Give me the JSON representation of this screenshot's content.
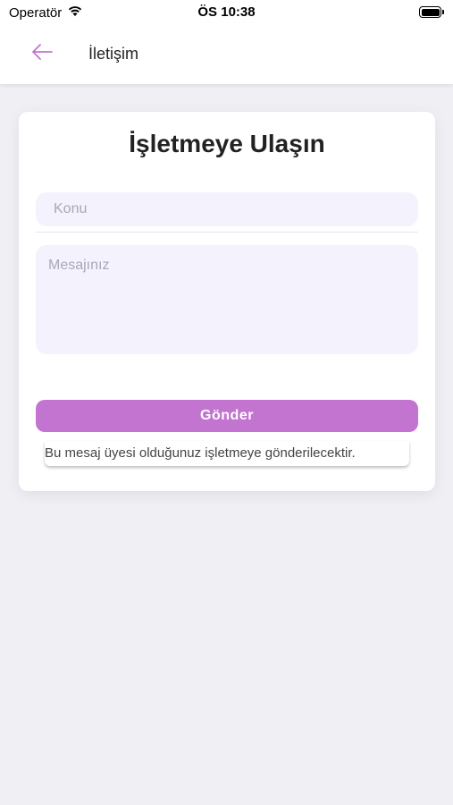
{
  "status_bar": {
    "carrier": "Operatör",
    "time": "ÖS 10:38"
  },
  "header": {
    "title": "İletişim",
    "back_icon": "arrow-left-icon",
    "accent_color": "#c374d1"
  },
  "form": {
    "title": "İşletmeye Ulaşın",
    "subject_placeholder": "Konu",
    "subject_value": "",
    "message_placeholder": "Mesajınız",
    "message_value": "",
    "send_label": "Gönder",
    "note": "Bu mesaj üyesi olduğunuz işletmeye gönderilecektir.",
    "button_color": "#c374d1",
    "field_background": "#f4f3fd"
  }
}
